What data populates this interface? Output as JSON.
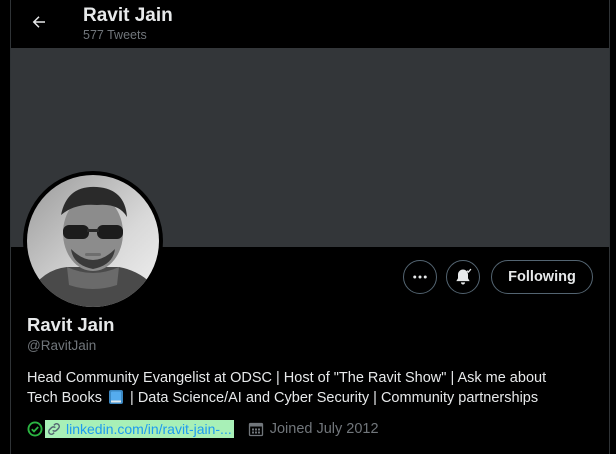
{
  "header": {
    "name": "Ravit Jain",
    "tweet_count": "577 Tweets"
  },
  "profile": {
    "name": "Ravit Jain",
    "handle": "@RavitJain",
    "bio_line1": "Head Community Evangelist at ODSC | Host of \"The Ravit Show\" | Ask me about",
    "bio_line2_pre": "Tech Books",
    "bio_line2_post": "| Data Science/AI and Cyber Security | Community partnerships",
    "link_text": "linkedin.com/in/ravit-jain-...",
    "joined": "Joined July 2012"
  },
  "buttons": {
    "following_label": "Following"
  },
  "icons": {
    "back": "arrow-left-icon",
    "more": "more-horizontal-icon",
    "notify": "bell-check-icon",
    "book": "blue-book-icon",
    "verified_check": "green-check-icon",
    "link": "link-icon",
    "calendar": "calendar-icon"
  },
  "colors": {
    "background": "#000000",
    "banner": "#333639",
    "text_primary": "#e7e9ea",
    "text_secondary": "#71767b",
    "link": "#1d9bf0",
    "link_highlight": "#a8f0b7",
    "border": "#536471"
  }
}
